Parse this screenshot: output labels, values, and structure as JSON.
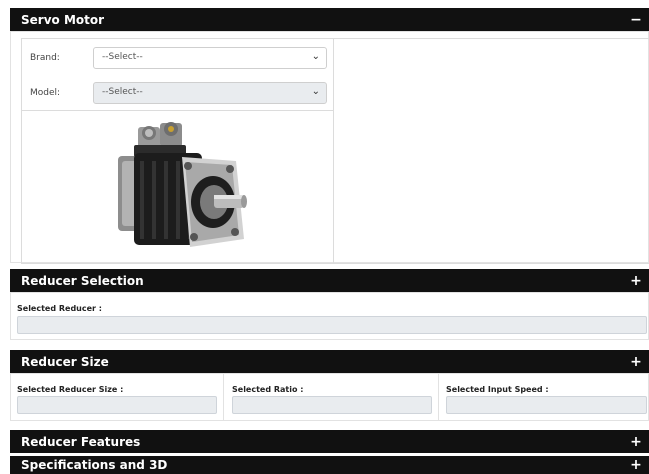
{
  "servo": {
    "title": "Servo Motor",
    "toggle": "−",
    "brand_label": "Brand:",
    "brand_value": "--Select--",
    "model_label": "Model:",
    "model_value": "--Select--"
  },
  "reducer_selection": {
    "title": "Reducer Selection",
    "toggle": "+",
    "field_label": "Selected Reducer :"
  },
  "reducer_size": {
    "title": "Reducer Size",
    "toggle": "+",
    "size_label": "Selected Reducer Size :",
    "ratio_label": "Selected Ratio :",
    "speed_label": "Selected Input Speed :"
  },
  "reducer_features": {
    "title": "Reducer Features",
    "toggle": "+"
  },
  "specs": {
    "title": "Specifications and 3D",
    "toggle": "+"
  }
}
